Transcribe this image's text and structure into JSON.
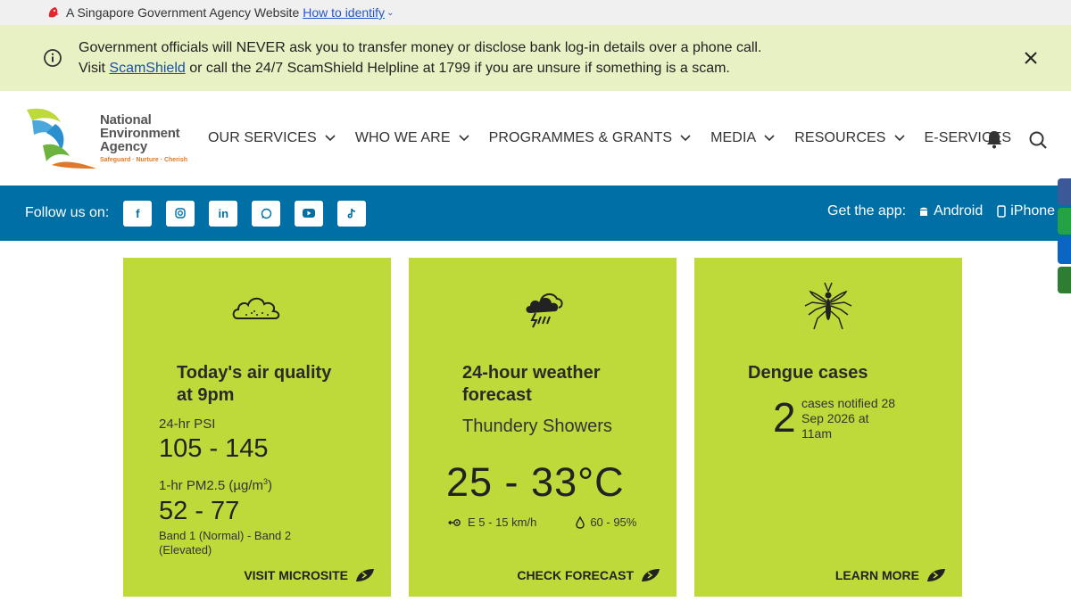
{
  "gov_banner": {
    "text": "A Singapore Government Agency Website",
    "link": "How to identify"
  },
  "alert": {
    "line1": "Government officials will NEVER ask you to transfer money or disclose bank log-in details over a phone call.",
    "line2_pre": "Visit ",
    "line2_link": "ScamShield",
    "line2_post": " or call the 24/7 ScamShield Helpline at 1799 if you are unsure if something is a scam."
  },
  "logo": {
    "line1": "National",
    "line2": "Environment",
    "line3": "Agency",
    "tagline": "Safeguard · Nurture · Cherish"
  },
  "nav": [
    {
      "label": "OUR SERVICES",
      "dropdown": true
    },
    {
      "label": "WHO WE ARE",
      "dropdown": true
    },
    {
      "label": "PROGRAMMES & GRANTS",
      "dropdown": true
    },
    {
      "label": "MEDIA",
      "dropdown": true
    },
    {
      "label": "RESOURCES",
      "dropdown": true
    },
    {
      "label": "E-SERVICES",
      "dropdown": false
    }
  ],
  "follow": {
    "label": "Follow us on:",
    "socials": [
      "facebook-icon",
      "instagram-icon",
      "linkedin-icon",
      "whatsapp-icon",
      "youtube-icon",
      "tiktok-icon"
    ],
    "get_app": "Get the app:",
    "android": "Android",
    "iphone": "iPhone"
  },
  "cards": {
    "air": {
      "title_line1": "Today's air quality",
      "title_line2": "at 9pm",
      "psi_label": "24-hr PSI",
      "psi_value": "105 - 145",
      "pm_label": "1-hr PM2.5 (µg/m",
      "pm_sup": "3",
      "pm_label_end": ")",
      "pm_value": "52 - 77",
      "band": "Band 1 (Normal) - Band 2 (Elevated)",
      "cta": "VISIT MICROSITE"
    },
    "weather": {
      "title_line1": "24-hour weather",
      "title_line2": "forecast",
      "condition": "Thundery Showers",
      "temp": "25 - 33°C",
      "wind": "E 5 - 15 km/h",
      "humidity": "60 - 95%",
      "cta": "CHECK FORECAST"
    },
    "dengue": {
      "title": "Dengue cases",
      "count": "2",
      "text": "cases notified 28 Sep 2026 at 11am",
      "cta": "LEARN MORE"
    }
  },
  "colors": {
    "card": "#bed93a",
    "followbar": "#006fa6",
    "alert_bg": "#e8f1c4"
  }
}
